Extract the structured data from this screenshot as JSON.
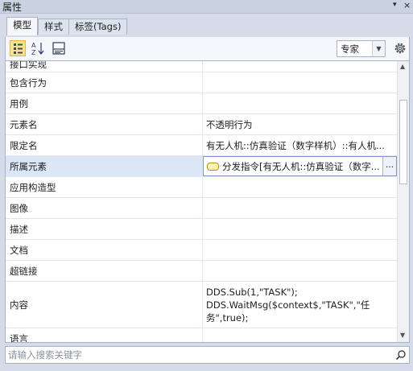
{
  "window": {
    "title": "属性",
    "pin_glyph": "▾",
    "close_glyph": "×"
  },
  "tabs": [
    {
      "label": "模型",
      "active": true
    },
    {
      "label": "样式",
      "active": false
    },
    {
      "label": "标签(Tags)",
      "active": false
    }
  ],
  "toolbar": {
    "buttons": [
      {
        "icon": "categorized-view-icon",
        "pressed": true
      },
      {
        "icon": "sort-alphabetical-icon",
        "pressed": false
      },
      {
        "icon": "description-pane-icon",
        "pressed": false
      }
    ],
    "mode_select": {
      "value": "专家",
      "arrow": "▼"
    },
    "settings_icon": "gear-icon"
  },
  "properties": [
    {
      "name": "接口实现",
      "value": ""
    },
    {
      "name": "包含行为",
      "value": ""
    },
    {
      "name": "用例",
      "value": ""
    },
    {
      "name": "元素名",
      "value": "不透明行为"
    },
    {
      "name": "限定名",
      "value": "有无人机::仿真验证（数字样机）::有人机..."
    },
    {
      "name": "所属元素",
      "value": "分发指令[有无人机::仿真验证（数字...",
      "selected": true,
      "has_chip": true,
      "ellipsis_button": "..."
    },
    {
      "name": "应用构造型",
      "value": ""
    },
    {
      "name": "图像",
      "value": ""
    },
    {
      "name": "描述",
      "value": ""
    },
    {
      "name": "文档",
      "value": ""
    },
    {
      "name": "超链接",
      "value": ""
    },
    {
      "name": "内容",
      "value": "DDS.Sub(1,\"TASK\");\nDDS.WaitMsg($context$,\"TASK\",\"任务\",true);"
    },
    {
      "name": "语言",
      "value": ""
    }
  ],
  "scrollbar": {
    "up": "▲",
    "down": "▼"
  },
  "search": {
    "placeholder": "请输入搜索关键字",
    "value": ""
  },
  "colors": {
    "selected_row": "#dbe6f7",
    "pressed_button": "#fbe38a",
    "chip_fill": "#fff3a6"
  }
}
